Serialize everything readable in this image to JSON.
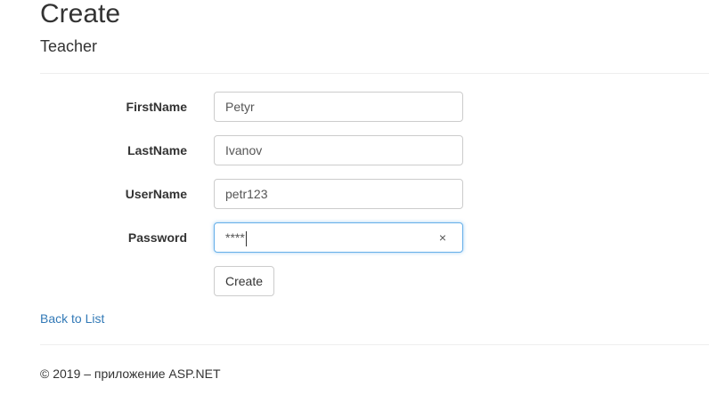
{
  "header": {
    "title": "Create",
    "subtitle": "Teacher"
  },
  "form": {
    "fields": [
      {
        "label": "FirstName",
        "value": "Petyr"
      },
      {
        "label": "LastName",
        "value": "Ivanov"
      },
      {
        "label": "UserName",
        "value": "petr123"
      },
      {
        "label": "Password",
        "value": "****",
        "clear_glyph": "×"
      }
    ],
    "submit_label": "Create"
  },
  "back_link_label": "Back to List",
  "footer": {
    "text": "© 2019 – приложение ASP.NET"
  },
  "colors": {
    "link": "#337ab7",
    "focus_border": "#66afe9"
  }
}
